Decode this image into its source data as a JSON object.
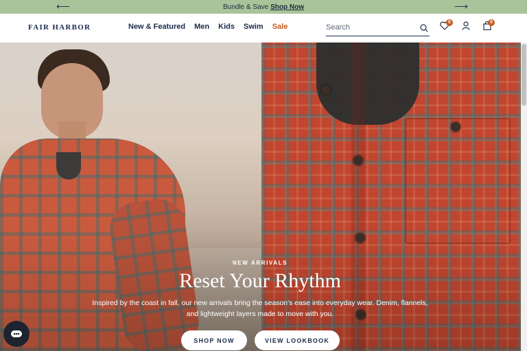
{
  "announcement": {
    "prev_arrow": "⟵",
    "next_arrow": "⟶",
    "text": "Bundle & Save",
    "link": "Shop Now"
  },
  "header": {
    "logo": "FAIR HARBOR",
    "nav": [
      "New & Featured",
      "Men",
      "Kids",
      "Swim",
      "Sale"
    ],
    "search_placeholder": "Search",
    "wishlist_count": "0",
    "cart_count": "0"
  },
  "hero": {
    "eyebrow": "NEW ARRIVALS",
    "headline": "Reset Your Rhythm",
    "subtext": "Inspired by the coast in fall, our new arrivals bring the season's ease into everyday wear. Denim, flannels, and lightweight layers made to move with you.",
    "buttons": [
      "SHOP NOW",
      "VIEW LOOKBOOK"
    ]
  },
  "colors": {
    "announcement_bg": "#a9c49a",
    "navy": "#1a2a4a",
    "sale": "#c65a1e",
    "chat_bg": "#1d2430"
  },
  "icons": [
    "arrow-left-icon",
    "arrow-right-icon",
    "search-icon",
    "heart-icon",
    "user-icon",
    "bag-icon",
    "chat-icon"
  ]
}
